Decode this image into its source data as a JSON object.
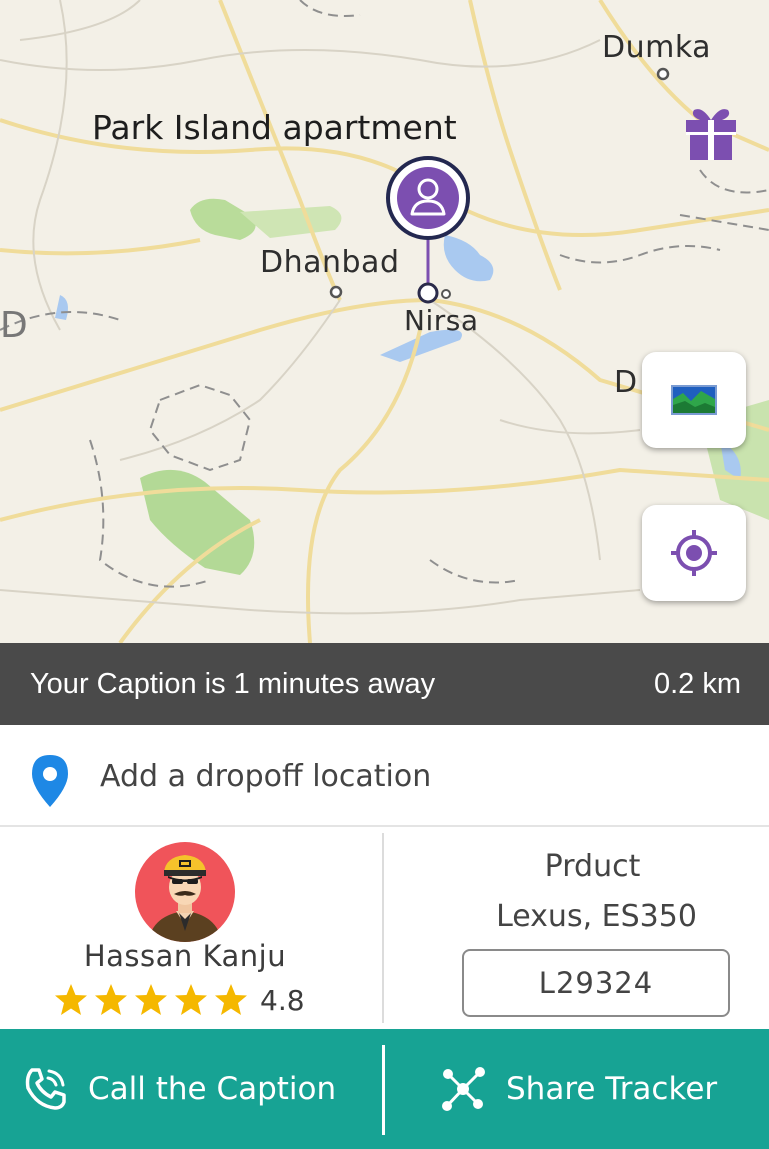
{
  "map": {
    "place_title": "Park Island apartment",
    "cities": {
      "dumka": "Dumka",
      "dhanbad": "Dhanbad",
      "nirsa": "Nirsa",
      "edge_left": "D",
      "edge_right": "D"
    }
  },
  "status": {
    "message": "Your Caption is 1 minutes away",
    "distance": "0.2 km"
  },
  "dropoff": {
    "label": "Add a dropoff location"
  },
  "driver": {
    "name": "Hassan Kanju",
    "rating": "4.8",
    "stars": 5
  },
  "vehicle": {
    "label": "Prduct",
    "name": "Lexus, ES350",
    "plate": "L29324"
  },
  "actions": {
    "call_label": "Call the Caption",
    "share_label": "Share Tracker"
  },
  "colors": {
    "accent": "#17a394",
    "pin": "#7c4fb0",
    "status_bar": "#4a4a4a",
    "star": "#f5b800"
  },
  "icons": {
    "gift": "gift-icon",
    "layers": "map-layer-icon",
    "locate": "crosshair-icon",
    "dropoff": "location-pin-icon",
    "call": "phone-icon",
    "share": "share-network-icon"
  }
}
